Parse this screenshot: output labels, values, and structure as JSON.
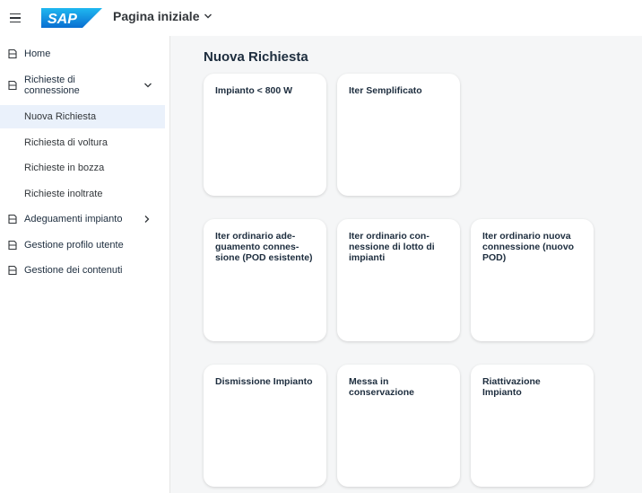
{
  "header": {
    "logo_text": "SAP",
    "app_title": "Pagina iniziale",
    "menu_icon": "hamburger-icon",
    "dropdown_icon": "chevron-down-icon"
  },
  "sidenav": {
    "items": [
      {
        "label": "Home",
        "icon": "home-icon"
      },
      {
        "label": "Richieste di connessione",
        "label_line1": "Richieste di",
        "label_line2": "connessione",
        "icon": "document-icon",
        "expanded": true
      },
      {
        "label": "Adeguamenti impianto",
        "icon": "document-icon",
        "expanded": false
      },
      {
        "label": "Gestione profilo utente",
        "icon": "document-icon"
      },
      {
        "label": "Gestione dei contenuti",
        "icon": "document-icon"
      }
    ],
    "subitems": [
      {
        "label": "Nuova Richiesta",
        "selected": true
      },
      {
        "label": "Richiesta di voltura"
      },
      {
        "label": "Richieste in bozza"
      },
      {
        "label": "Richieste inoltrate"
      }
    ]
  },
  "main": {
    "title": "Nuova Richiesta",
    "tiles": [
      {
        "title": "Impianto < 800 W"
      },
      {
        "title": "Iter Semplificato"
      },
      {
        "title": "Iter ordinario ade-guamento connes-sione (POD esistente)",
        "lines": [
          "Iter ordinario ade-",
          "guamento connes-",
          "sione (POD esistente)"
        ]
      },
      {
        "title": "Iter ordinario con-nessione di lotto di impianti",
        "lines": [
          "Iter ordinario con-",
          "nessione di lotto di",
          "impianti"
        ]
      },
      {
        "title": "Iter ordinario nuova connessione (nuovo POD)",
        "lines": [
          "Iter ordinario nuova",
          "connessione (nuovo",
          "POD)"
        ]
      },
      {
        "title": "Dismissione Impianto"
      },
      {
        "title": "Messa in conservazione",
        "lines": [
          "Messa in",
          "conservazione"
        ]
      },
      {
        "title": "Riattivazione Impianto",
        "lines": [
          "Riattivazione",
          "Impianto"
        ]
      }
    ]
  },
  "colors": {
    "sap_blue": "#0a6ed1",
    "selected_bg": "#eaf1fb",
    "content_bg": "#f5f6f7"
  }
}
